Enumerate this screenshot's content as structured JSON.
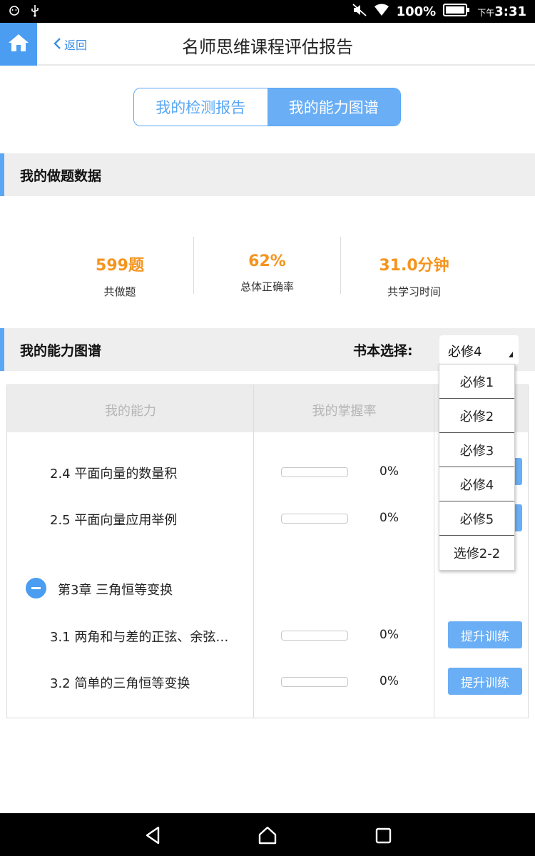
{
  "status_bar": {
    "battery": "100%",
    "time_prefix": "下午",
    "time": "3:31"
  },
  "header": {
    "back_label": "返回",
    "title": "名师思维课程评估报告"
  },
  "tabs": [
    {
      "label": "我的检测报告",
      "active": false
    },
    {
      "label": "我的能力图谱",
      "active": true
    }
  ],
  "practice_section": {
    "title": "我的做题数据",
    "stats": [
      {
        "value": "599题",
        "label": "共做题"
      },
      {
        "value": "62%",
        "label": "总体正确率"
      },
      {
        "value": "31.0分钟",
        "label": "共学习时间"
      }
    ]
  },
  "ability_section": {
    "title": "我的能力图谱",
    "book_label": "书本选择:",
    "book_selected": "必修4",
    "book_options": [
      "必修1",
      "必修2",
      "必修3",
      "必修4",
      "必修5",
      "选修2-2"
    ]
  },
  "table": {
    "headers": [
      "我的能力",
      "我的掌握率"
    ],
    "rows": [
      {
        "name": "2.4 平面向量的数量积",
        "mastery": 0,
        "pct": "0%"
      },
      {
        "name": "2.5 平面向量应用举例",
        "mastery": 0,
        "pct": "0%"
      },
      {
        "name": "3.1 两角和与差的正弦、余弦…",
        "mastery": 0,
        "pct": "0%",
        "button": "提升训练"
      },
      {
        "name": "3.2 简单的三角恒等变换",
        "mastery": 0,
        "pct": "0%",
        "button": "提升训练"
      }
    ],
    "chapter": "第3章 三角恒等变换"
  },
  "colors": {
    "accent": "#5aa7f5",
    "stat_value": "#f5941d",
    "home": "#4a9df0"
  }
}
